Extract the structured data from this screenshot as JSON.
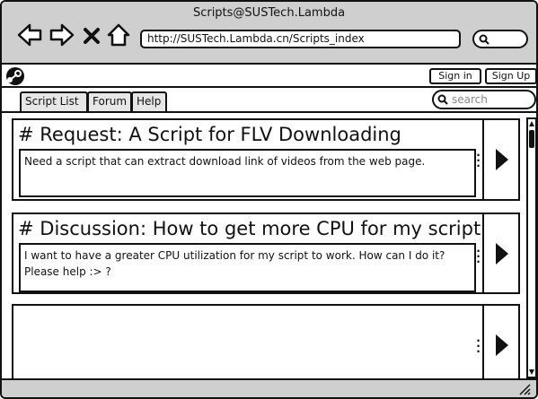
{
  "window": {
    "title": "Scripts@SUSTech.Lambda"
  },
  "toolbar": {
    "back_icon": "back-arrow-icon",
    "forward_icon": "forward-arrow-icon",
    "stop_icon": "close-icon",
    "home_icon": "home-icon",
    "url": "http://SUSTech.Lambda.cn/Scripts_index",
    "search_icon": "search-icon"
  },
  "account": {
    "logo_icon": "steam-logo-icon",
    "sign_in_label": "Sign in",
    "sign_up_label": "Sign Up"
  },
  "tabs": [
    {
      "label": "Script List",
      "active": true
    },
    {
      "label": "Forum",
      "active": false
    },
    {
      "label": "Help",
      "active": false
    }
  ],
  "search": {
    "placeholder": "search"
  },
  "posts": [
    {
      "title": "# Request: A Script for FLV Downloading",
      "body": "Need a script that can extract download link of videos from the web page."
    },
    {
      "title": "# Discussion: How to get more CPU for my script",
      "body": "I want to have a greater CPU utilization for my script to work. How can I do it? Please help :> ?"
    },
    {
      "title": "",
      "body": ""
    }
  ],
  "colors": {
    "chrome_bg": "#cfcfcf",
    "tab_bg": "#e6e6e6",
    "stroke": "#111111"
  }
}
